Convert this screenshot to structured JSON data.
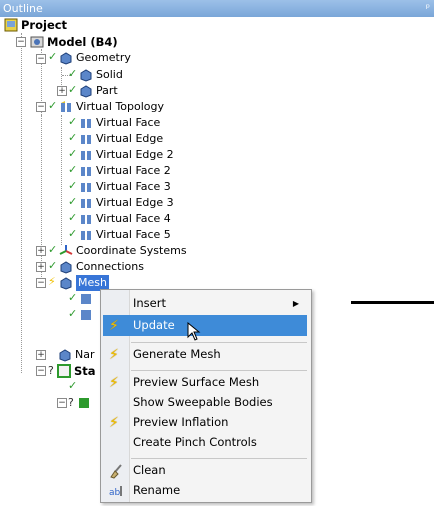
{
  "panel": {
    "title": "Outline",
    "pin": "ᵖ"
  },
  "tree": {
    "project": "Project",
    "model": "Model (B4)",
    "geometry": "Geometry",
    "solid": "Solid",
    "part": "Part",
    "virtual_topology": "Virtual Topology",
    "vt_items": [
      "Virtual Face",
      "Virtual Edge",
      "Virtual Edge 2",
      "Virtual Face 2",
      "Virtual Face 3",
      "Virtual Edge 3",
      "Virtual Face 4",
      "Virtual Face 5"
    ],
    "coordinate_systems": "Coordinate Systems",
    "connections": "Connections",
    "mesh": "Mesh",
    "named_partial": "Nar",
    "static_partial": "Sta"
  },
  "context_menu": {
    "items": [
      {
        "label": "Insert",
        "icon": "none",
        "submenu": true
      },
      {
        "label": "Update",
        "icon": "lightning-icon",
        "selected": true
      },
      {
        "label": "Generate Mesh",
        "icon": "lightning-icon"
      },
      {
        "label": "Preview Surface Mesh",
        "icon": "lightning-icon"
      },
      {
        "label": "Show Sweepable Bodies",
        "icon": "none"
      },
      {
        "label": "Preview Inflation",
        "icon": "lightning-icon"
      },
      {
        "label": "Create Pinch Controls",
        "icon": "none"
      },
      {
        "label": "Clean",
        "icon": "broom-icon"
      },
      {
        "label": "Rename",
        "icon": "rename-icon"
      }
    ]
  },
  "colors": {
    "accent": "#3e8bd8",
    "check": "#2d9a2d",
    "bolt": "#f0c000"
  }
}
